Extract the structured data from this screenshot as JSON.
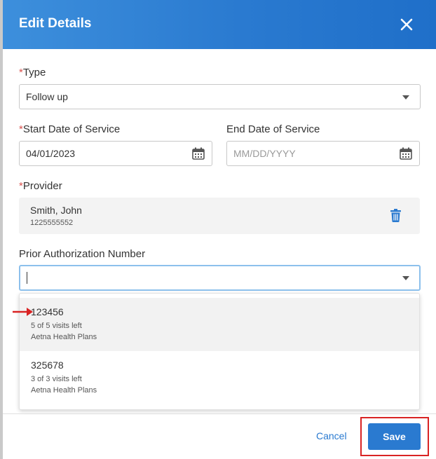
{
  "modal": {
    "title": "Edit Details"
  },
  "form": {
    "type": {
      "required_mark": "*",
      "label": "Type",
      "value": "Follow up"
    },
    "start_date": {
      "required_mark": "*",
      "label": "Start Date of Service",
      "value": "04/01/2023"
    },
    "end_date": {
      "label": "End Date of Service",
      "placeholder": "MM/DD/YYYY"
    },
    "provider": {
      "required_mark": "*",
      "label": "Provider",
      "name": "Smith, John",
      "id": "1225555552"
    },
    "prior_auth": {
      "label": "Prior Authorization Number",
      "value": "",
      "options": [
        {
          "number": "123456",
          "visits": "5 of 5 visits left",
          "plan": "Aetna Health Plans"
        },
        {
          "number": "325678",
          "visits": "3 of 3 visits left",
          "plan": "Aetna Health Plans"
        }
      ]
    }
  },
  "footer": {
    "cancel_label": "Cancel",
    "save_label": "Save"
  },
  "colors": {
    "header_blue": "#2a7ad0",
    "required_red": "#d9534f",
    "annotation_red": "#d92323",
    "trash_blue": "#2a7ad0"
  }
}
